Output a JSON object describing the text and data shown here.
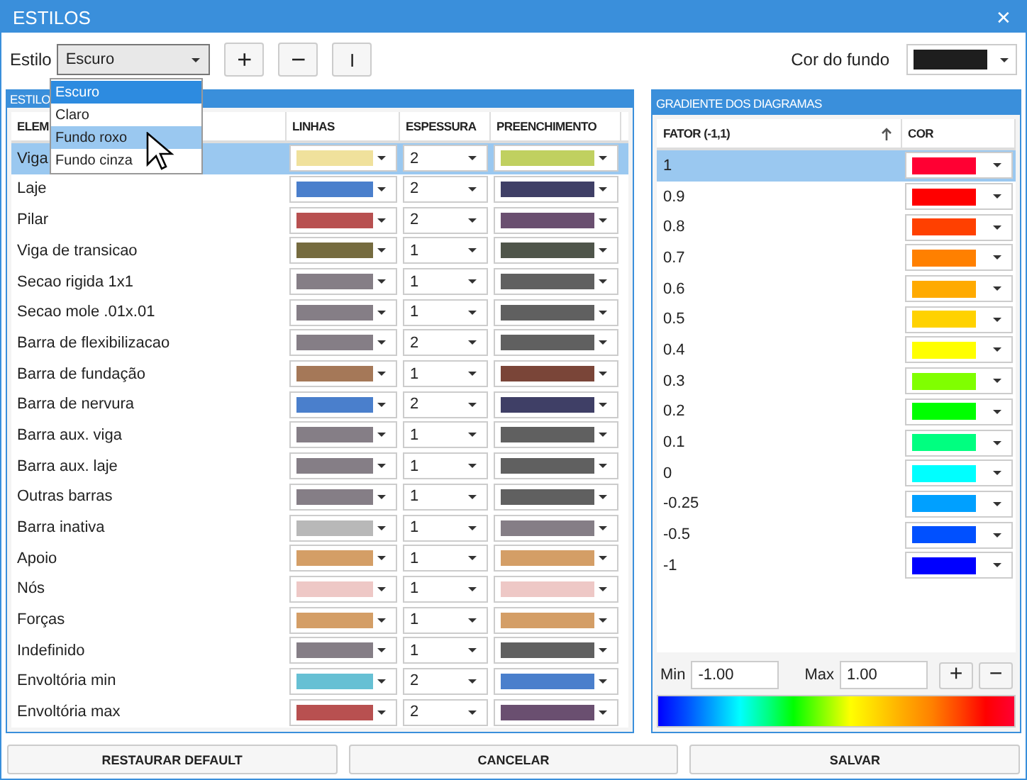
{
  "window": {
    "title": "ESTILOS",
    "close": "✕"
  },
  "toolbar": {
    "style_label": "Estilo",
    "style_value": "Escuro",
    "add": "+",
    "remove": "−",
    "rename": "I",
    "background_label": "Cor do fundo",
    "background": {
      "color": "#1e1e1e"
    }
  },
  "style_menu": {
    "items": [
      {
        "label": "Escuro",
        "selected": true,
        "hovered": false
      },
      {
        "label": "Claro",
        "selected": false,
        "hovered": false
      },
      {
        "label": "Fundo roxo",
        "selected": false,
        "hovered": true
      },
      {
        "label": "Fundo cinza",
        "selected": false,
        "hovered": false
      }
    ]
  },
  "styles_panel": {
    "title": "ESTILO",
    "columns": [
      "ELEM",
      "LINHAS",
      "ESPESSURA",
      "PREENCHIMENTO"
    ],
    "rows": [
      {
        "element": "Viga",
        "line": {
          "color": "#f0e19c"
        },
        "thickness": "2",
        "fill": {
          "color": "#c0d060"
        },
        "selected": true
      },
      {
        "element": "Laje",
        "line": {
          "color": "#4a7fcc"
        },
        "thickness": "2",
        "fill": {
          "color": "#3f3f66"
        },
        "selected": false
      },
      {
        "element": "Pilar",
        "line": {
          "color": "#b85050"
        },
        "thickness": "2",
        "fill": {
          "color": "#6a4f70"
        },
        "selected": false
      },
      {
        "element": "Viga de transicao",
        "line": {
          "color": "#756b3f"
        },
        "thickness": "1",
        "fill": {
          "color": "#4f554a"
        },
        "selected": false
      },
      {
        "element": "Secao rigida 1x1",
        "line": {
          "color": "#857e86"
        },
        "thickness": "1",
        "fill": {
          "color": "#606060"
        },
        "selected": false
      },
      {
        "element": "Secao mole .01x.01",
        "line": {
          "color": "#857e86"
        },
        "thickness": "1",
        "fill": {
          "color": "#606060"
        },
        "selected": false
      },
      {
        "element": "Barra de flexibilizacao",
        "line": {
          "color": "#857e86"
        },
        "thickness": "2",
        "fill": {
          "color": "#606060"
        },
        "selected": false
      },
      {
        "element": "Barra de fundação",
        "line": {
          "color": "#a57858"
        },
        "thickness": "1",
        "fill": {
          "color": "#7a4538"
        },
        "selected": false
      },
      {
        "element": "Barra de nervura",
        "line": {
          "color": "#4a7fcc"
        },
        "thickness": "2",
        "fill": {
          "color": "#3f3f66"
        },
        "selected": false
      },
      {
        "element": "Barra aux. viga",
        "line": {
          "color": "#857e86"
        },
        "thickness": "1",
        "fill": {
          "color": "#606060"
        },
        "selected": false
      },
      {
        "element": "Barra aux. laje",
        "line": {
          "color": "#857e86"
        },
        "thickness": "1",
        "fill": {
          "color": "#606060"
        },
        "selected": false
      },
      {
        "element": "Outras barras",
        "line": {
          "color": "#857e86"
        },
        "thickness": "1",
        "fill": {
          "color": "#606060"
        },
        "selected": false
      },
      {
        "element": "Barra inativa",
        "line": {
          "color": "#b8b8b8"
        },
        "thickness": "1",
        "fill": {
          "color": "#857e86"
        },
        "selected": false
      },
      {
        "element": "Apoio",
        "line": {
          "color": "#d49e66"
        },
        "thickness": "1",
        "fill": {
          "color": "#d49e66"
        },
        "selected": false
      },
      {
        "element": "Nós",
        "line": {
          "color": "#eec8c6"
        },
        "thickness": "1",
        "fill": {
          "color": "#eec8c6"
        },
        "selected": false
      },
      {
        "element": "Forças",
        "line": {
          "color": "#d49e66"
        },
        "thickness": "1",
        "fill": {
          "color": "#d49e66"
        },
        "selected": false
      },
      {
        "element": "Indefinido",
        "line": {
          "color": "#857e86"
        },
        "thickness": "1",
        "fill": {
          "color": "#606060"
        },
        "selected": false
      },
      {
        "element": "Envoltória min",
        "line": {
          "color": "#66c0d4"
        },
        "thickness": "2",
        "fill": {
          "color": "#4a7fcc"
        },
        "selected": false
      },
      {
        "element": "Envoltória max",
        "line": {
          "color": "#b85050"
        },
        "thickness": "2",
        "fill": {
          "color": "#6a4f70"
        },
        "selected": false
      }
    ]
  },
  "gradient_panel": {
    "title": "GRADIENTE DOS DIAGRAMAS",
    "columns": [
      "FATOR (-1,1)",
      "COR"
    ],
    "rows": [
      {
        "factor": "1",
        "color": "#ff0033",
        "selected": true
      },
      {
        "factor": "0.9",
        "color": "#ff0000",
        "selected": false
      },
      {
        "factor": "0.8",
        "color": "#ff4000",
        "selected": false
      },
      {
        "factor": "0.7",
        "color": "#ff8000",
        "selected": false
      },
      {
        "factor": "0.6",
        "color": "#ffaa00",
        "selected": false
      },
      {
        "factor": "0.5",
        "color": "#ffd200",
        "selected": false
      },
      {
        "factor": "0.4",
        "color": "#ffff00",
        "selected": false
      },
      {
        "factor": "0.3",
        "color": "#80ff00",
        "selected": false
      },
      {
        "factor": "0.2",
        "color": "#00ff00",
        "selected": false
      },
      {
        "factor": "0.1",
        "color": "#00ff80",
        "selected": false
      },
      {
        "factor": "0",
        "color": "#00ffff",
        "selected": false
      },
      {
        "factor": "-0.25",
        "color": "#00a0ff",
        "selected": false
      },
      {
        "factor": "-0.5",
        "color": "#0050ff",
        "selected": false
      },
      {
        "factor": "-1",
        "color": "#0000ff",
        "selected": false
      }
    ],
    "min_label": "Min",
    "min_value": "-1.00",
    "max_label": "Max",
    "max_value": "1.00",
    "add": "+",
    "remove": "−"
  },
  "buttons": [
    "RESTAURAR DEFAULT",
    "CANCELAR",
    "SALVAR"
  ]
}
